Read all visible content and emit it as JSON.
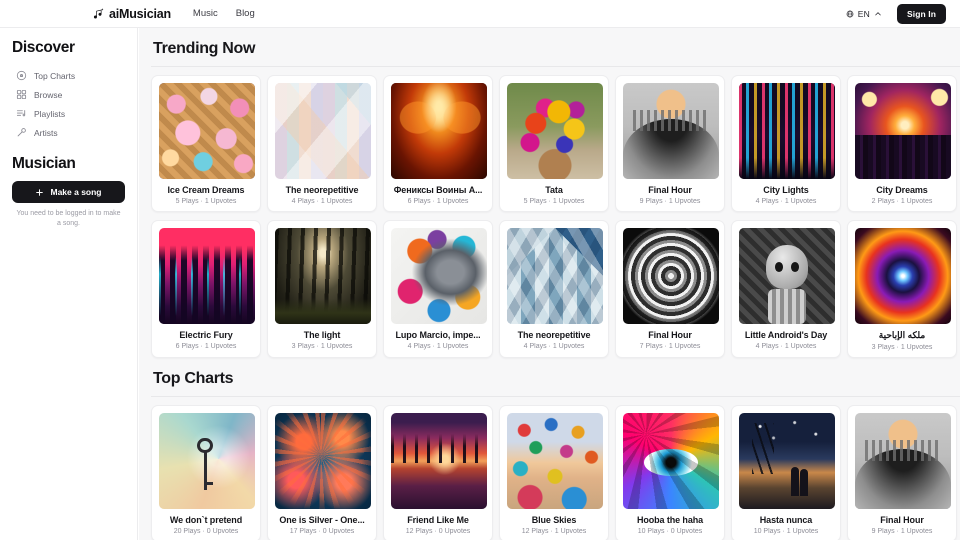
{
  "header": {
    "logo_icon": "music-note-sparkle-icon",
    "brand": "aiMusician",
    "nav": [
      {
        "label": "Music"
      },
      {
        "label": "Blog"
      }
    ],
    "language": {
      "icon": "globe-icon",
      "code": "EN",
      "chevron": "chevron-up-icon"
    },
    "signin_label": "Sign In"
  },
  "sidebar": {
    "discover_title": "Discover",
    "items": [
      {
        "label": "Top Charts",
        "icon": "disc-chart-icon"
      },
      {
        "label": "Browse",
        "icon": "grid-icon"
      },
      {
        "label": "Playlists",
        "icon": "playlist-icon"
      },
      {
        "label": "Artists",
        "icon": "microphone-icon"
      }
    ],
    "musician_title": "Musician",
    "make_song_label": "Make a song",
    "make_song_icon": "plus-icon",
    "login_note": "You need to be logged in to make a song."
  },
  "sections": [
    {
      "title": "Trending Now",
      "rows": [
        [
          {
            "title": "Ice Cream Dreams",
            "meta": "5 Plays · 1 Upvotes",
            "art": "ice-cream"
          },
          {
            "title": "The neorepetitive",
            "meta": "4 Plays · 1 Upvotes",
            "art": "pastel-geo"
          },
          {
            "title": "Фениксы Воины А...",
            "meta": "6 Plays · 1 Upvotes",
            "art": "phoenix"
          },
          {
            "title": "Tata",
            "meta": "5 Plays · 1 Upvotes",
            "art": "flowers"
          },
          {
            "title": "Final Hour",
            "meta": "9 Plays · 1 Upvotes",
            "art": "grey-city"
          },
          {
            "title": "City Lights",
            "meta": "4 Plays · 1 Upvotes",
            "art": "neon-city"
          },
          {
            "title": "City Dreams",
            "meta": "2 Plays · 1 Upvotes",
            "art": "sunset-city"
          }
        ],
        [
          {
            "title": "Electric Fury",
            "meta": "6 Plays · 1 Upvotes",
            "art": "electric-city"
          },
          {
            "title": "The light",
            "meta": "3 Plays · 1 Upvotes",
            "art": "forest-light"
          },
          {
            "title": "Lupo Marcio, impe...",
            "meta": "4 Plays · 1 Upvotes",
            "art": "wolf"
          },
          {
            "title": "The neorepetitive",
            "meta": "4 Plays · 1 Upvotes",
            "art": "blue-triangles"
          },
          {
            "title": "Final Hour",
            "meta": "7 Plays · 1 Upvotes",
            "art": "grey-swirl"
          },
          {
            "title": "Little Android's Day",
            "meta": "4 Plays · 1 Upvotes",
            "art": "android"
          },
          {
            "title": "ملكه الإباحية",
            "meta": "3 Plays · 1 Upvotes",
            "art": "nebula"
          }
        ]
      ]
    },
    {
      "title": "Top Charts",
      "rows": [
        [
          {
            "title": "We don`t pretend",
            "meta": "20 Plays · 0 Upvotes",
            "art": "key"
          },
          {
            "title": "One is Silver - One...",
            "meta": "17 Plays · 0 Upvotes",
            "art": "coral"
          },
          {
            "title": "Friend Like Me",
            "meta": "12 Plays · 0 Upvotes",
            "art": "lake-sunset"
          },
          {
            "title": "Blue Skies",
            "meta": "12 Plays · 1 Upvotes",
            "art": "balloons"
          },
          {
            "title": "Hooba the haha",
            "meta": "10 Plays · 0 Upvotes",
            "art": "psyche-eye"
          },
          {
            "title": "Hasta nunca",
            "meta": "10 Plays · 1 Upvotes",
            "art": "night-walk"
          },
          {
            "title": "Final Hour",
            "meta": "9 Plays · 1 Upvotes",
            "art": "grey-city"
          }
        ]
      ]
    }
  ],
  "theme": {
    "accent_dark": "#17171b",
    "page_bg": "#f7f7f8",
    "panel_bg": "#ffffff",
    "border": "#ececee",
    "text_primary": "#17171b",
    "text_muted": "#8d8d97"
  }
}
